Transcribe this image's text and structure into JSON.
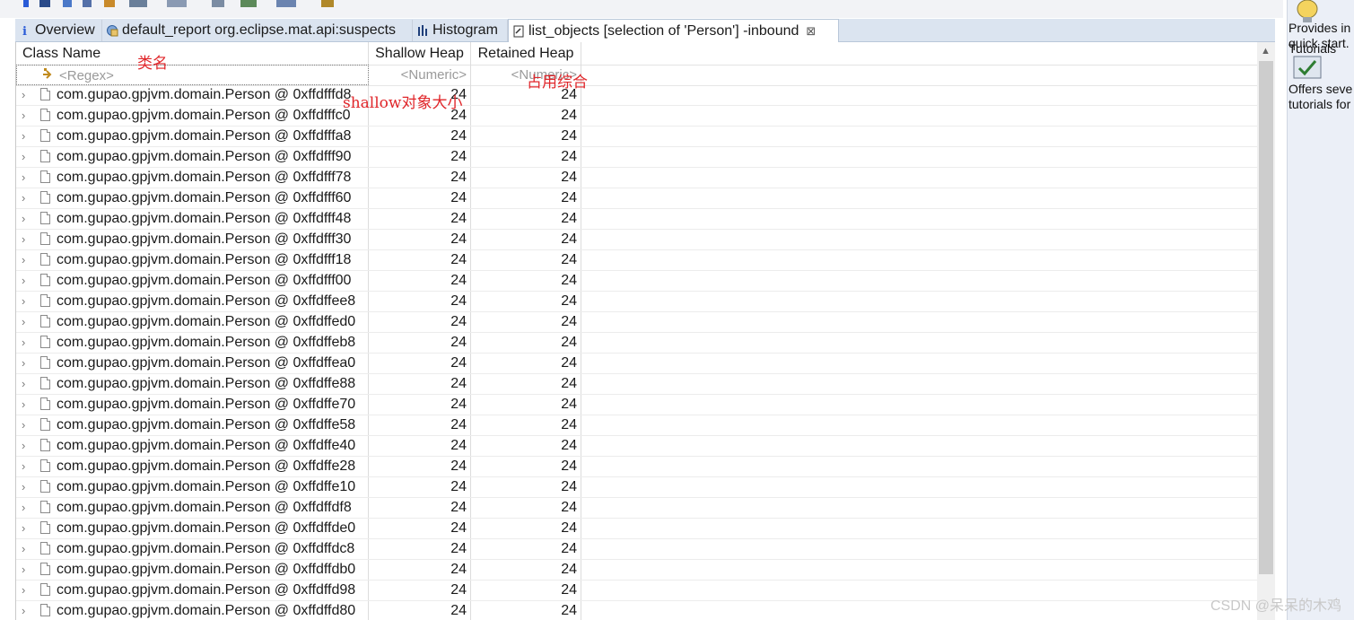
{
  "tabs": [
    {
      "label": "Overview",
      "icon": "info-icon"
    },
    {
      "label": "default_report  org.eclipse.mat.api:suspects",
      "icon": "report-icon"
    },
    {
      "label": "Histogram",
      "icon": "histogram-icon"
    },
    {
      "label": "list_objects  [selection of 'Person'] -inbound",
      "icon": "query-icon",
      "close": "⊠"
    }
  ],
  "columns": {
    "class_name": "Class Name",
    "shallow_heap": "Shallow Heap",
    "retained_heap": "Retained Heap"
  },
  "filters": {
    "class_name": "<Regex>",
    "shallow_heap": "<Numeric>",
    "retained_heap": "<Numeric>"
  },
  "rows": [
    {
      "object": "com.gupao.gpjvm.domain.Person @ 0xffdfffd8",
      "shallow": "24",
      "retained": "24"
    },
    {
      "object": "com.gupao.gpjvm.domain.Person @ 0xffdfffc0",
      "shallow": "24",
      "retained": "24"
    },
    {
      "object": "com.gupao.gpjvm.domain.Person @ 0xffdfffa8",
      "shallow": "24",
      "retained": "24"
    },
    {
      "object": "com.gupao.gpjvm.domain.Person @ 0xffdfff90",
      "shallow": "24",
      "retained": "24"
    },
    {
      "object": "com.gupao.gpjvm.domain.Person @ 0xffdfff78",
      "shallow": "24",
      "retained": "24"
    },
    {
      "object": "com.gupao.gpjvm.domain.Person @ 0xffdfff60",
      "shallow": "24",
      "retained": "24"
    },
    {
      "object": "com.gupao.gpjvm.domain.Person @ 0xffdfff48",
      "shallow": "24",
      "retained": "24"
    },
    {
      "object": "com.gupao.gpjvm.domain.Person @ 0xffdfff30",
      "shallow": "24",
      "retained": "24"
    },
    {
      "object": "com.gupao.gpjvm.domain.Person @ 0xffdfff18",
      "shallow": "24",
      "retained": "24"
    },
    {
      "object": "com.gupao.gpjvm.domain.Person @ 0xffdfff00",
      "shallow": "24",
      "retained": "24"
    },
    {
      "object": "com.gupao.gpjvm.domain.Person @ 0xffdffee8",
      "shallow": "24",
      "retained": "24"
    },
    {
      "object": "com.gupao.gpjvm.domain.Person @ 0xffdffed0",
      "shallow": "24",
      "retained": "24"
    },
    {
      "object": "com.gupao.gpjvm.domain.Person @ 0xffdffeb8",
      "shallow": "24",
      "retained": "24"
    },
    {
      "object": "com.gupao.gpjvm.domain.Person @ 0xffdffea0",
      "shallow": "24",
      "retained": "24"
    },
    {
      "object": "com.gupao.gpjvm.domain.Person @ 0xffdffe88",
      "shallow": "24",
      "retained": "24"
    },
    {
      "object": "com.gupao.gpjvm.domain.Person @ 0xffdffe70",
      "shallow": "24",
      "retained": "24"
    },
    {
      "object": "com.gupao.gpjvm.domain.Person @ 0xffdffe58",
      "shallow": "24",
      "retained": "24"
    },
    {
      "object": "com.gupao.gpjvm.domain.Person @ 0xffdffe40",
      "shallow": "24",
      "retained": "24"
    },
    {
      "object": "com.gupao.gpjvm.domain.Person @ 0xffdffe28",
      "shallow": "24",
      "retained": "24"
    },
    {
      "object": "com.gupao.gpjvm.domain.Person @ 0xffdffe10",
      "shallow": "24",
      "retained": "24"
    },
    {
      "object": "com.gupao.gpjvm.domain.Person @ 0xffdffdf8",
      "shallow": "24",
      "retained": "24"
    },
    {
      "object": "com.gupao.gpjvm.domain.Person @ 0xffdffde0",
      "shallow": "24",
      "retained": "24"
    },
    {
      "object": "com.gupao.gpjvm.domain.Person @ 0xffdffdc8",
      "shallow": "24",
      "retained": "24"
    },
    {
      "object": "com.gupao.gpjvm.domain.Person @ 0xffdffdb0",
      "shallow": "24",
      "retained": "24"
    },
    {
      "object": "com.gupao.gpjvm.domain.Person @ 0xffdffd98",
      "shallow": "24",
      "retained": "24"
    },
    {
      "object": "com.gupao.gpjvm.domain.Person @ 0xffdffd80",
      "shallow": "24",
      "retained": "24"
    }
  ],
  "annotations": {
    "class_name_note": "类名",
    "shallow_note": "shallow对象大小",
    "retained_note": "占用综合"
  },
  "side_panel": {
    "line1": "Provides in",
    "line2": "quick start.",
    "line3": "Tutorials",
    "line4": "Offers seve",
    "line5": "tutorials for"
  },
  "watermark": "CSDN @呆呆的木鸡",
  "colors": {
    "annotation": "#e0262a",
    "tabbar": "#dbe4f0",
    "scroll_thumb": "#cdcdcd"
  }
}
